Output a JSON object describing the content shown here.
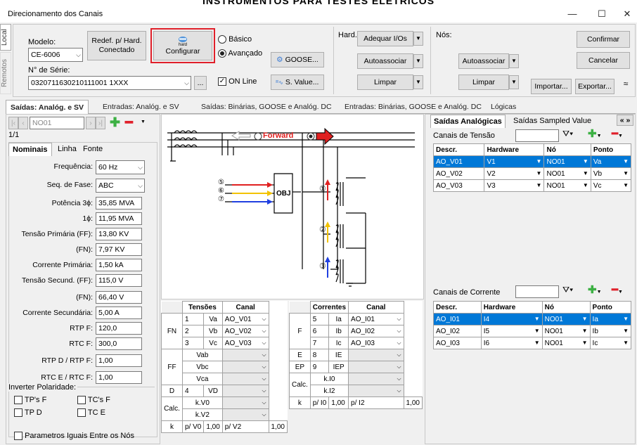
{
  "banner": "INSTRUMENTOS PARA TESTES ELÉTRICOS",
  "window": {
    "title": "Direcionamento dos Canais",
    "minimize": "—",
    "maximize": "☐",
    "close": "✕"
  },
  "side_tabs": {
    "local": "Local",
    "remotos": "Remotos"
  },
  "top": {
    "modelo_label": "Modelo:",
    "modelo_value": "CE-6006",
    "redef_btn": "Redef. p/ Hard. Conectado",
    "configurar_btn": "Configurar",
    "configurar_icon_text": "hard",
    "serie_label": "N° de Série:",
    "serie_value": "0320711630210111001 1XXX",
    "ellipsis": "...",
    "basico": "Básico",
    "avancado": "Avançado",
    "online": "ON Line",
    "goose_btn": "GOOSE...",
    "sv_btn": "S. Value...",
    "hard_label": "Hard.:",
    "adequar_btn": "Adequar I/Os",
    "autoassociar_btn": "Autoassociar",
    "limpar_btn": "Limpar",
    "nos_label": "Nós:",
    "nos_autoassociar_btn": "Autoassociar",
    "nos_limpar_btn": "Limpar",
    "importar_btn": "Importar...",
    "exportar_btn": "Exportar...",
    "confirmar_btn": "Confirmar",
    "cancelar_btn": "Cancelar"
  },
  "main_tabs": [
    "Saídas: Analóg. e SV",
    "Entradas: Analóg. e SV",
    "Saídas: Binárias, GOOSE e Analóg. DC",
    "Entradas: Binárias, GOOSE e Analóg. DC",
    "Lógicas"
  ],
  "left": {
    "node_value": "NO01",
    "counter": "1/1",
    "subtabs": [
      "Nominais",
      "Linha",
      "Fonte"
    ],
    "rows": [
      {
        "label": "Frequência:",
        "value": "60 Hz",
        "combo": true
      },
      {
        "label": "Seq. de Fase:",
        "value": "ABC",
        "combo": true
      },
      {
        "label": "Potência 3ϕ:",
        "value": "35,85 MVA"
      },
      {
        "label": "1ϕ:",
        "value": "11,95 MVA"
      },
      {
        "label": "Tensão Primária (FF):",
        "value": "13,80 KV"
      },
      {
        "label": "(FN):",
        "value": "7,97 KV"
      },
      {
        "label": "Corrente Primária:",
        "value": "1,50 kA"
      },
      {
        "label": "Tensão Secund. (FF):",
        "value": "115,0 V"
      },
      {
        "label": "(FN):",
        "value": "66,40 V"
      },
      {
        "label": "Corrente Secundária:",
        "value": "5,00 A"
      },
      {
        "label": "RTP F:",
        "value": "120,0"
      },
      {
        "label": "RTC F:",
        "value": "300,0"
      },
      {
        "label": "RTP D / RTP F:",
        "value": "1,00"
      },
      {
        "label": "RTC E / RTC F:",
        "value": "1,00"
      }
    ],
    "inverter_label": "Inverter Polaridade:",
    "checks": [
      "TP's F",
      "TC's F",
      "TP D",
      "TC E"
    ],
    "parametros": "Parametros Iguais Entre os Nós"
  },
  "diagram": {
    "forward": "Forward",
    "obj": "OBJ",
    "markers": [
      "⑤",
      "⑥",
      "⑦",
      "①",
      "②",
      "③"
    ]
  },
  "tensoes_table": {
    "headers": [
      "Tensões",
      "Canal"
    ],
    "rows": [
      {
        "g": "FN",
        "n": "1",
        "name": "Va",
        "canal": "AO_V01"
      },
      {
        "g": "",
        "n": "2",
        "name": "Vb",
        "canal": "AO_V02"
      },
      {
        "g": "",
        "n": "3",
        "name": "Vc",
        "canal": "AO_V03"
      },
      {
        "g": "FF",
        "n": "",
        "name": "Vab",
        "canal": ""
      },
      {
        "g": "",
        "n": "",
        "name": "Vbc",
        "canal": ""
      },
      {
        "g": "",
        "n": "",
        "name": "Vca",
        "canal": ""
      },
      {
        "g": "D",
        "n": "4",
        "name": "VD",
        "canal": ""
      },
      {
        "g": "Calc.",
        "n": "",
        "name": "k.V0",
        "canal": ""
      },
      {
        "g": "",
        "n": "",
        "name": "k.V2",
        "canal": ""
      }
    ],
    "footer": [
      "k",
      "p/ V0",
      "1,00",
      "p/ V2",
      "1,00"
    ]
  },
  "correntes_table": {
    "headers": [
      "Correntes",
      "Canal"
    ],
    "rows": [
      {
        "g": "F",
        "n": "5",
        "name": "Ia",
        "canal": "AO_I01"
      },
      {
        "g": "",
        "n": "6",
        "name": "Ib",
        "canal": "AO_I02"
      },
      {
        "g": "",
        "n": "7",
        "name": "Ic",
        "canal": "AO_I03"
      },
      {
        "g": "E",
        "n": "8",
        "name": "IE",
        "canal": ""
      },
      {
        "g": "EP",
        "n": "9",
        "name": "IEP",
        "canal": ""
      },
      {
        "g": "Calc.",
        "n": "",
        "name": "k.I0",
        "canal": ""
      },
      {
        "g": "",
        "n": "",
        "name": "k.I2",
        "canal": ""
      }
    ],
    "footer": [
      "k",
      "p/ I0",
      "1,00",
      "p/ I2",
      "1,00"
    ]
  },
  "right": {
    "tabs": [
      "Saídas Analógicas",
      "Saídas Sampled Value"
    ],
    "nav": "« »",
    "tensao_label": "Canais de Tensão",
    "corrente_label": "Canais de Corrente",
    "headers": [
      "Descr.",
      "Hardware",
      "Nó",
      "Ponto"
    ],
    "tensao_rows": [
      {
        "d": "AO_V01",
        "h": "V1",
        "n": "NO01",
        "p": "Va",
        "selected": true
      },
      {
        "d": "AO_V02",
        "h": "V2",
        "n": "NO01",
        "p": "Vb"
      },
      {
        "d": "AO_V03",
        "h": "V3",
        "n": "NO01",
        "p": "Vc"
      }
    ],
    "corrente_rows": [
      {
        "d": "AO_I01",
        "h": "I4",
        "n": "NO01",
        "p": "Ia",
        "selected": true
      },
      {
        "d": "AO_I02",
        "h": "I5",
        "n": "NO01",
        "p": "Ib"
      },
      {
        "d": "AO_I03",
        "h": "I6",
        "n": "NO01",
        "p": "Ic"
      }
    ]
  },
  "colors": {
    "accent": "#0078d7",
    "highlight_border": "#e0202a",
    "arrow_red": "#e02020",
    "arrow_yellow": "#f2c200",
    "arrow_blue": "#2040e0",
    "plus_green": "#3cb043",
    "minus_red": "#e0202a"
  }
}
